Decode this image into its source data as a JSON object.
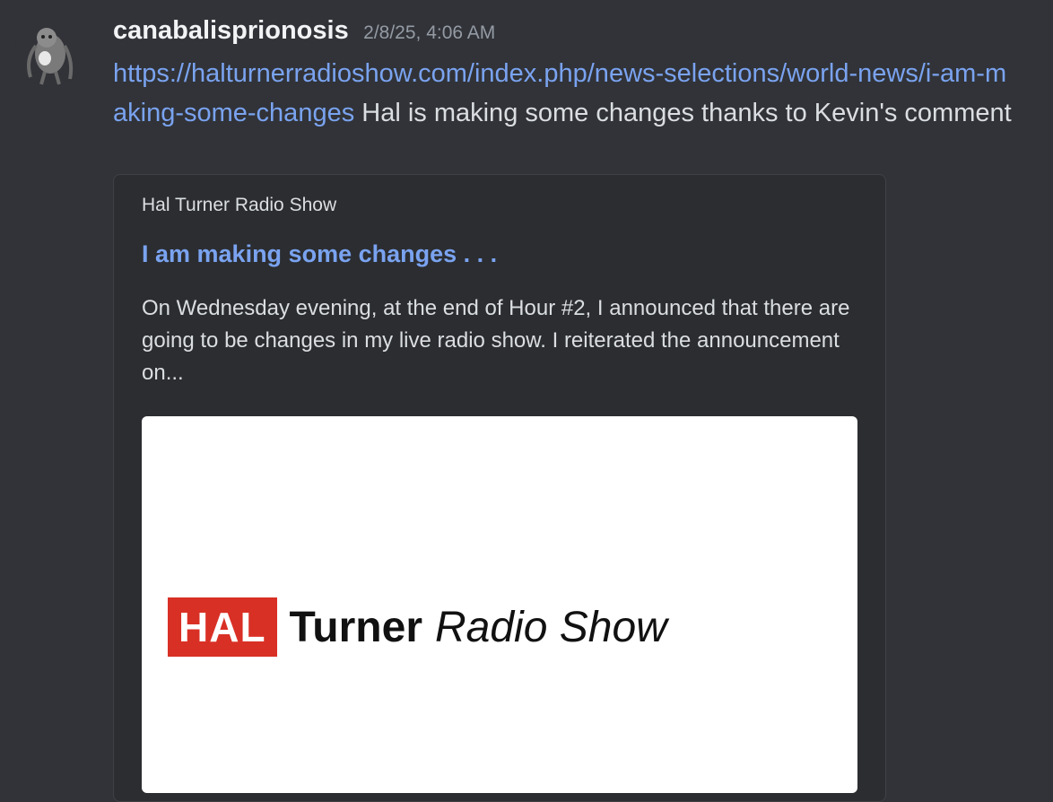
{
  "message": {
    "username": "canabalisprionosis",
    "timestamp": "2/8/25, 4:06 AM",
    "link_text": "https://halturnerradioshow.com/index.php/news-selections/world-news/i-am-making-some-changes",
    "body_text": " Hal is making some changes thanks to Kevin's comment"
  },
  "embed": {
    "provider": "Hal Turner Radio Show",
    "title": "I am making some changes . . .",
    "description": "On Wednesday evening, at the end of Hour #2, I announced that there are going to be changes in my live radio show.  I reiterated the announcement on...",
    "image": {
      "logo_box_text": "HAL",
      "logo_turner": "Turner",
      "logo_radio_show": "Radio Show"
    }
  },
  "colors": {
    "background": "#313338",
    "link": "#7aa3f0",
    "embed_bg": "#2b2d31",
    "logo_red": "#d93025"
  }
}
